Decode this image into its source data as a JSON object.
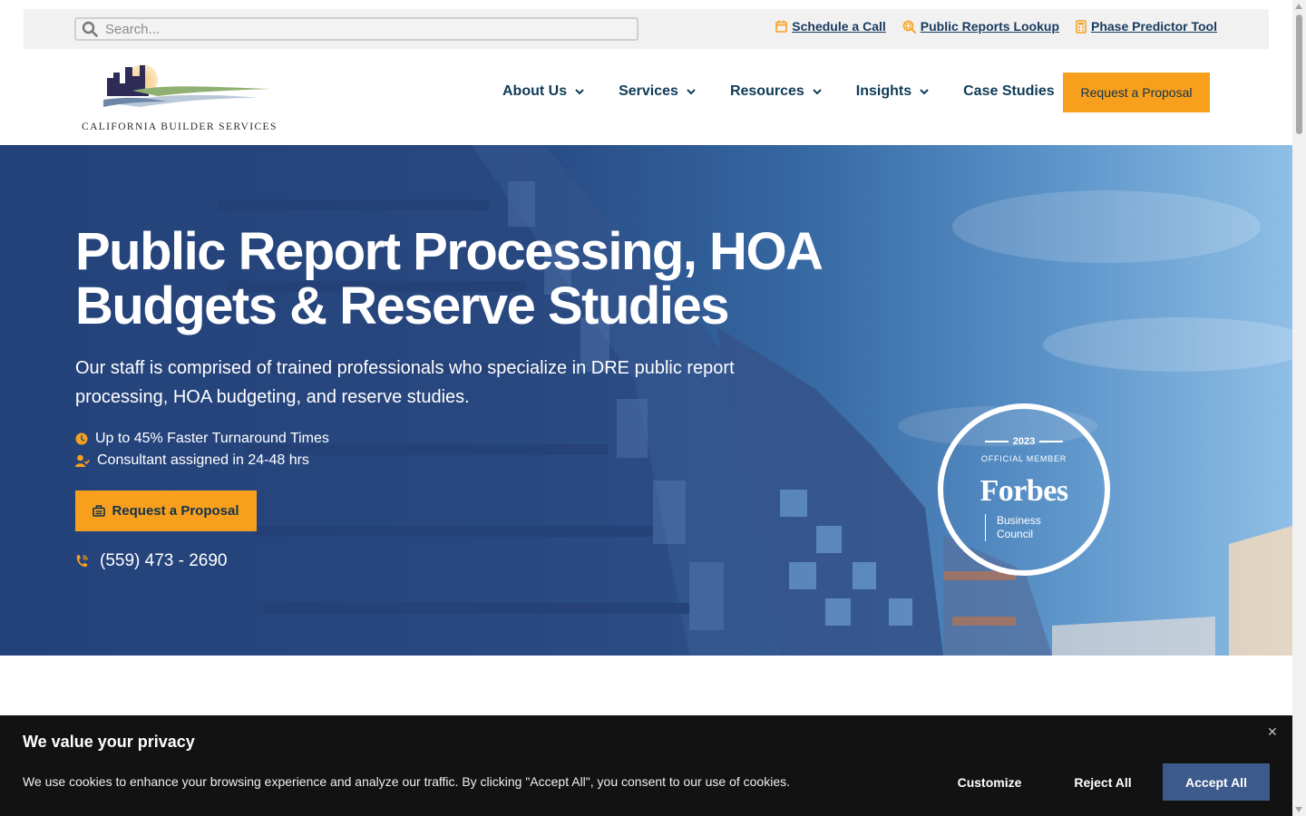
{
  "search": {
    "placeholder": "Search..."
  },
  "utility_links": [
    {
      "label": "Schedule a Call",
      "icon": "calendar-icon"
    },
    {
      "label": "Public Reports Lookup",
      "icon": "search-document-icon"
    },
    {
      "label": "Phase Predictor Tool",
      "icon": "calculator-icon"
    }
  ],
  "logo": {
    "text": "California Builder Services"
  },
  "nav": {
    "items": [
      {
        "label": "About Us",
        "dropdown": true
      },
      {
        "label": "Services",
        "dropdown": true
      },
      {
        "label": "Resources",
        "dropdown": true
      },
      {
        "label": "Insights",
        "dropdown": true
      },
      {
        "label": "Case Studies",
        "dropdown": false
      }
    ],
    "cta_label": "Request a Proposal"
  },
  "hero": {
    "title": "Public Report Processing, HOA Budgets & Reserve Studies",
    "subtitle": "Our staff is comprised of trained professionals who specialize in DRE public report processing, HOA budgeting, and reserve studies.",
    "features": [
      {
        "text": "Up to 45% Faster Turnaround Times",
        "icon": "clock-icon"
      },
      {
        "text": "Consultant assigned in 24-48 hrs",
        "icon": "user-check-icon"
      }
    ],
    "cta_label": "Request a Proposal",
    "phone": "(559) 473 - 2690"
  },
  "badge": {
    "year": "2023",
    "member": "OFFICIAL MEMBER",
    "brand": "Forbes",
    "council_line1": "Business",
    "council_line2": "Council"
  },
  "cookie": {
    "title": "We value your privacy",
    "text": "We use cookies to enhance your browsing experience and analyze our traffic. By clicking \"Accept All\", you consent to our use of cookies.",
    "customize": "Customize",
    "reject": "Reject All",
    "accept": "Accept All"
  },
  "colors": {
    "accent": "#f8a01d",
    "nav_text": "#0f3b57",
    "link": "#163a5f",
    "hero_blue": "#2a4f88",
    "cookie_bg": "#121212",
    "accept_bg": "#3d5a8c"
  }
}
